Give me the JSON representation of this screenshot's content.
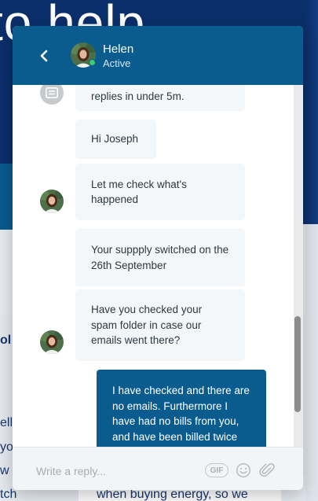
{
  "background_site": {
    "hero_text": "to help",
    "left_fragments": [
      "ol",
      "ell",
      "yo",
      "w",
      "tch"
    ],
    "card_text": "when buying energy, so we"
  },
  "chat": {
    "header": {
      "agent_name": "Helen",
      "agent_status": "Active",
      "back_icon": "chevron-left-icon"
    },
    "messages": [
      {
        "direction": "in",
        "text": "replies in under 5m."
      },
      {
        "direction": "in",
        "text": "Hi Joseph"
      },
      {
        "direction": "in",
        "text": "Let me check what's happened"
      },
      {
        "direction": "in",
        "text": "Your suppply switched on the 26th September"
      },
      {
        "direction": "in",
        "text": "Have you checked your spam folder in case our emails went there?"
      },
      {
        "direction": "out",
        "text": "I have checked and there are no emails. Furthermore I have had no bills from you, and have been billed twice"
      }
    ],
    "composer": {
      "placeholder": "Write a reply...",
      "gif_label": "GIF",
      "emoji_icon": "smiley-icon",
      "attach_icon": "paperclip-icon"
    },
    "colors": {
      "header": "#0a5c8f",
      "outgoing_bubble": "#0a5c8f",
      "incoming_bubble": "#f3f7fa",
      "presence": "#3ccb6a"
    }
  }
}
